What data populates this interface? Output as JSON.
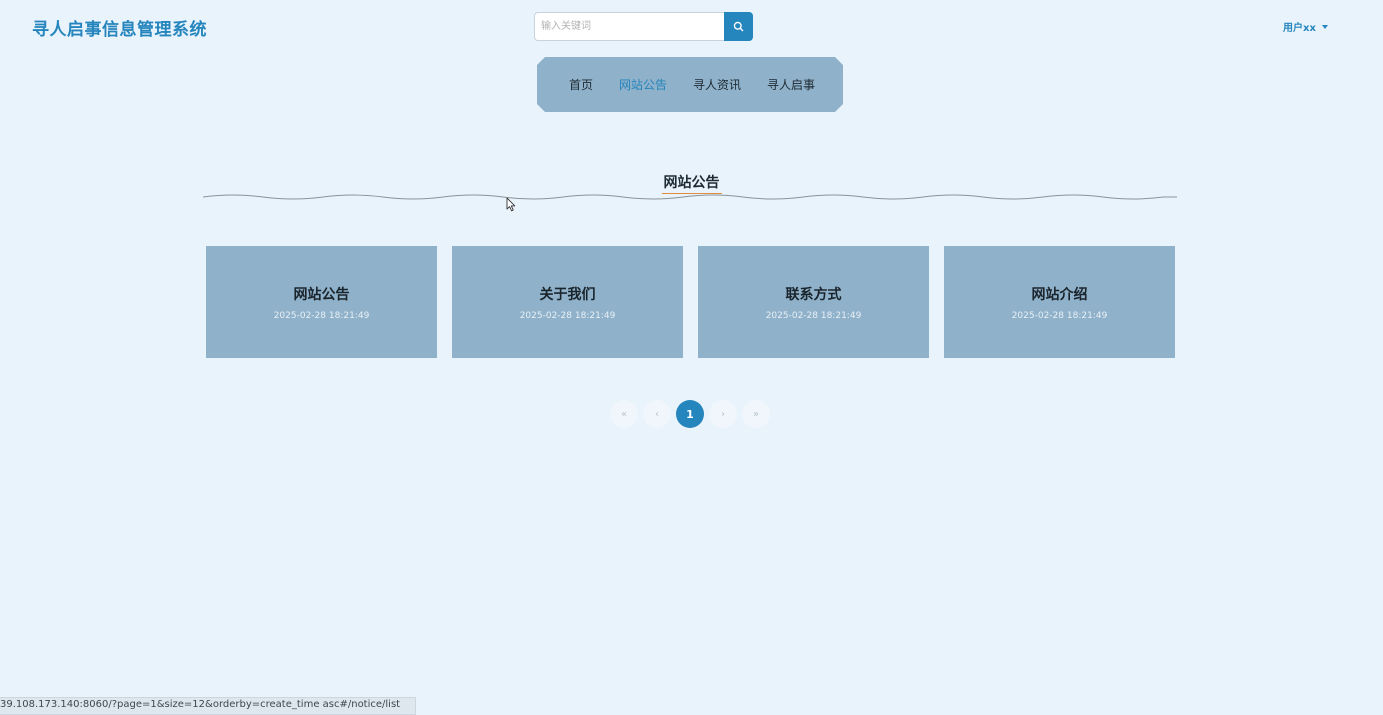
{
  "header": {
    "site_title": "寻人启事信息管理系统",
    "search_placeholder": "输入关键词",
    "user_label": "用户xx"
  },
  "nav": {
    "items": [
      {
        "label": "首页",
        "active": false
      },
      {
        "label": "网站公告",
        "active": true
      },
      {
        "label": "寻人资讯",
        "active": false
      },
      {
        "label": "寻人启事",
        "active": false
      }
    ]
  },
  "section": {
    "title": "网站公告"
  },
  "notices": [
    {
      "title": "网站公告",
      "date": "2025-02-28 18:21:49"
    },
    {
      "title": "关于我们",
      "date": "2025-02-28 18:21:49"
    },
    {
      "title": "联系方式",
      "date": "2025-02-28 18:21:49"
    },
    {
      "title": "网站介绍",
      "date": "2025-02-28 18:21:49"
    }
  ],
  "pagination": {
    "first": "«",
    "prev": "‹",
    "current": "1",
    "next": "›",
    "last": "»"
  },
  "status_bar": {
    "url": "39.108.173.140:8060/?page=1&size=12&orderby=create_time asc#/notice/list"
  },
  "colors": {
    "accent": "#2585bd",
    "background": "#e9f3fc",
    "card": "#8fb1c9",
    "underline": "#e08d3c"
  }
}
